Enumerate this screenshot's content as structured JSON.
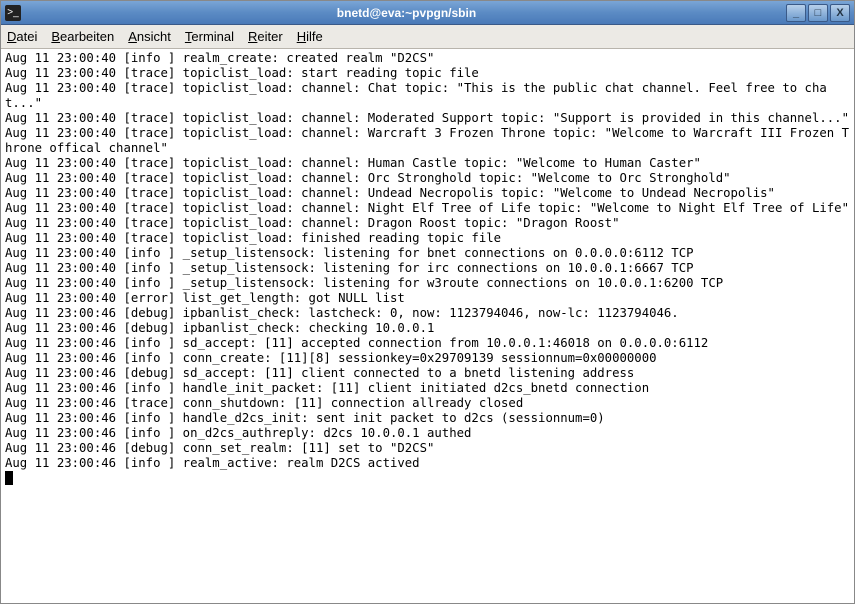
{
  "window": {
    "title": "bnetd@eva:~pvpgn/sbin"
  },
  "win_controls": {
    "minimize": "_",
    "maximize": "□",
    "close": "X"
  },
  "menu": {
    "items": [
      {
        "accel": "D",
        "rest": "atei"
      },
      {
        "accel": "B",
        "rest": "earbeiten"
      },
      {
        "accel": "A",
        "rest": "nsicht"
      },
      {
        "accel": "T",
        "rest": "erminal"
      },
      {
        "accel": "R",
        "rest": "eiter"
      },
      {
        "accel": "H",
        "rest": "ilfe"
      }
    ]
  },
  "log": {
    "lines": [
      "Aug 11 23:00:40 [info ] realm_create: created realm \"D2CS\"",
      "Aug 11 23:00:40 [trace] topiclist_load: start reading topic file",
      "Aug 11 23:00:40 [trace] topiclist_load: channel: Chat topic: \"This is the public chat channel. Feel free to chat...\"",
      "Aug 11 23:00:40 [trace] topiclist_load: channel: Moderated Support topic: \"Support is provided in this channel...\"",
      "Aug 11 23:00:40 [trace] topiclist_load: channel: Warcraft 3 Frozen Throne topic: \"Welcome to Warcraft III Frozen Throne offical channel\"",
      "Aug 11 23:00:40 [trace] topiclist_load: channel: Human Castle topic: \"Welcome to Human Caster\"",
      "Aug 11 23:00:40 [trace] topiclist_load: channel: Orc Stronghold topic: \"Welcome to Orc Stronghold\"",
      "Aug 11 23:00:40 [trace] topiclist_load: channel: Undead Necropolis topic: \"Welcome to Undead Necropolis\"",
      "Aug 11 23:00:40 [trace] topiclist_load: channel: Night Elf Tree of Life topic: \"Welcome to Night Elf Tree of Life\"",
      "Aug 11 23:00:40 [trace] topiclist_load: channel: Dragon Roost topic: \"Dragon Roost\"",
      "Aug 11 23:00:40 [trace] topiclist_load: finished reading topic file",
      "Aug 11 23:00:40 [info ] _setup_listensock: listening for bnet connections on 0.0.0.0:6112 TCP",
      "Aug 11 23:00:40 [info ] _setup_listensock: listening for irc connections on 10.0.0.1:6667 TCP",
      "Aug 11 23:00:40 [info ] _setup_listensock: listening for w3route connections on 10.0.0.1:6200 TCP",
      "Aug 11 23:00:40 [error] list_get_length: got NULL list",
      "Aug 11 23:00:46 [debug] ipbanlist_check: lastcheck: 0, now: 1123794046, now-lc: 1123794046.",
      "Aug 11 23:00:46 [debug] ipbanlist_check: checking 10.0.0.1",
      "Aug 11 23:00:46 [info ] sd_accept: [11] accepted connection from 10.0.0.1:46018 on 0.0.0.0:6112",
      "Aug 11 23:00:46 [info ] conn_create: [11][8] sessionkey=0x29709139 sessionnum=0x00000000",
      "Aug 11 23:00:46 [debug] sd_accept: [11] client connected to a bnetd listening address",
      "Aug 11 23:00:46 [info ] handle_init_packet: [11] client initiated d2cs_bnetd connection",
      "Aug 11 23:00:46 [trace] conn_shutdown: [11] connection allready closed",
      "Aug 11 23:00:46 [info ] handle_d2cs_init: sent init packet to d2cs (sessionnum=0)",
      "Aug 11 23:00:46 [info ] on_d2cs_authreply: d2cs 10.0.0.1 authed",
      "Aug 11 23:00:46 [debug] conn_set_realm: [11] set to \"D2CS\"",
      "Aug 11 23:00:46 [info ] realm_active: realm D2CS actived"
    ]
  }
}
